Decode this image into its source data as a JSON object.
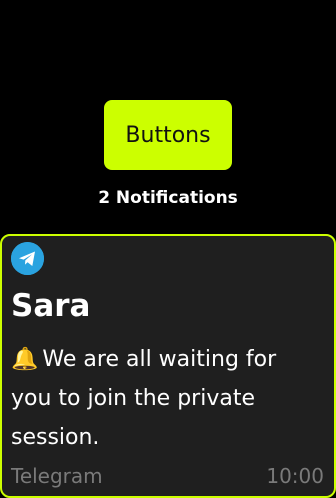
{
  "header": {
    "button_label": "Buttons",
    "notifications_count": "2 Notifications"
  },
  "notification": {
    "app_icon": "telegram-icon",
    "sender": "Sara",
    "emoji": "🔔",
    "message": "We are all waiting for you to join the private session.",
    "app_name": "Telegram",
    "time": "10:00"
  },
  "colors": {
    "accent": "#ccff00",
    "card_background": "#1f1f1f",
    "telegram_blue": "#2aa3e0"
  }
}
